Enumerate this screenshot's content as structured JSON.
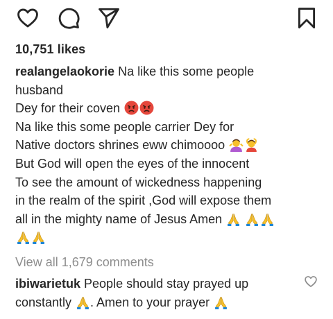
{
  "actions": {
    "like_icon": "heart-icon",
    "comment_icon": "comment-icon",
    "share_icon": "send-icon",
    "save_icon": "bookmark-icon"
  },
  "likes_text": "10,751 likes",
  "caption": {
    "username": "realangelaokorie",
    "lines": [
      " Na like this some people",
      "husband",
      "Dey for their coven ",
      "Na like this some people carrier Dey for",
      "Native doctors shrines eww chimoooo ",
      "But God will open the eyes of the innocent",
      "To see the amount of wickedness happening",
      "in the realm of the spirit ,God will expose them",
      "all in the mighty name of Jesus Amen "
    ]
  },
  "view_all": "View all 1,679 comments",
  "comment": {
    "username": "ibiwarietuk",
    "line1": " People should stay prayed up",
    "line2a": "constantly ",
    "line2b": ". Amen to your prayer "
  },
  "colors": {
    "text": "#262626",
    "muted": "#8e8e8e",
    "emoji_yellow": "#f7c02b",
    "emoji_angry": "#e5473c"
  }
}
